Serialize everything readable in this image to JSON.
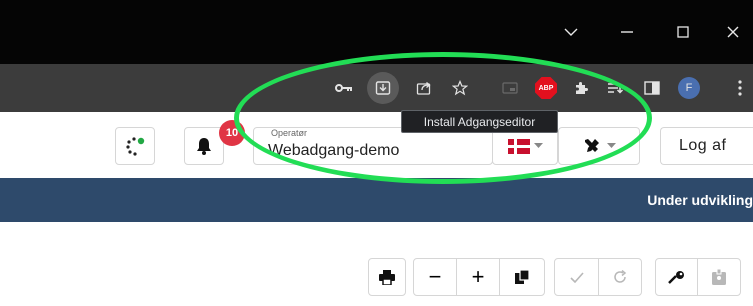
{
  "browser": {
    "window_controls": [
      "chevron-down-icon",
      "minimize-icon",
      "maximize-icon",
      "close-icon"
    ],
    "toolbar_icons": [
      "key-icon",
      "install-icon",
      "share-icon",
      "star-icon",
      "picture-in-picture-icon",
      "adblock-icon",
      "extensions-icon",
      "reading-list-icon",
      "side-panel-icon",
      "profile-icon",
      "more-icon"
    ],
    "adblock_label": "ABP",
    "profile_initial": "F",
    "tooltip": "Install Adgangseditor",
    "highlight_color": "#22dd55"
  },
  "header": {
    "notification_count": "10",
    "operator_label": "Operatør",
    "operator_value": "Webadgang-demo",
    "logout_label": "Log af",
    "badge_color": "#e03545"
  },
  "banner": {
    "text": "Under udvikling",
    "color": "#2e4a6b"
  },
  "toolbar_buttons": {
    "minus": "−",
    "plus": "+"
  }
}
